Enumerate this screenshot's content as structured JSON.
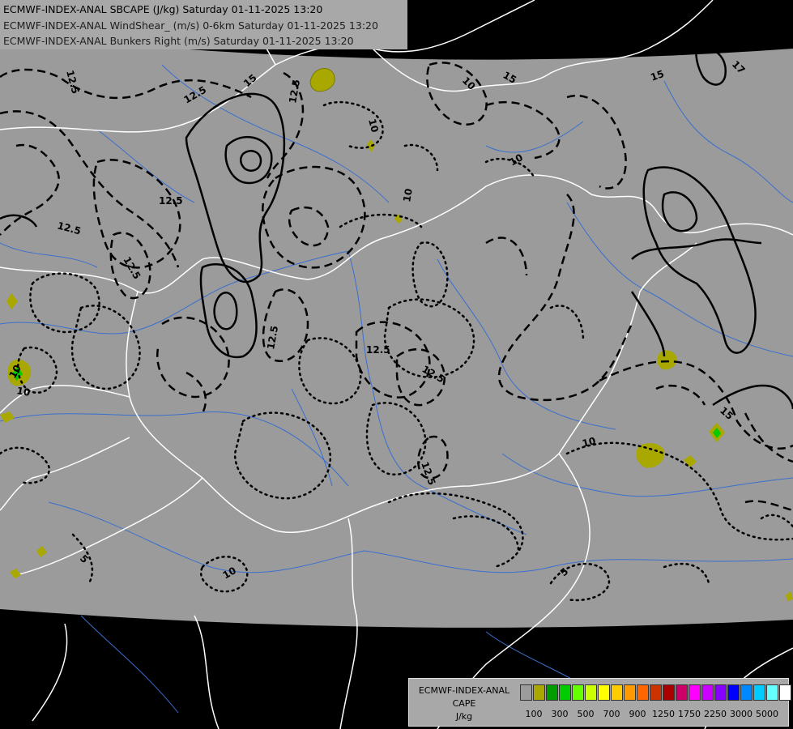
{
  "header": {
    "line1": "ECMWF-INDEX-ANAL SBCAPE (J/kg) Saturday 01-11-2025 13:20",
    "line2": "ECMWF-INDEX-ANAL WindShear_ (m/s) 0-6km Saturday 01-11-2025 13:20",
    "line3": "ECMWF-INDEX-ANAL Bunkers Right (m/s) Saturday 01-11-2025 13:20"
  },
  "legend": {
    "title1": "ECMWF-INDEX-ANAL",
    "title2": "CAPE",
    "title3": "J/kg",
    "colors": [
      "#9c9c9c",
      "#a8a800",
      "#009c00",
      "#00cc00",
      "#66ff00",
      "#ccff00",
      "#ffff00",
      "#ffcc00",
      "#ff9900",
      "#ff6600",
      "#cc3300",
      "#aa0000",
      "#cc0066",
      "#ff00ff",
      "#cc00ff",
      "#8800ff",
      "#0000ff",
      "#0088ff",
      "#00ccff",
      "#66ffff",
      "#ffffff"
    ],
    "ticks": [
      "100",
      "300",
      "500",
      "700",
      "900",
      "1250",
      "1750",
      "2250",
      "3000",
      "5000"
    ]
  },
  "map": {
    "colors": {
      "grey": "#9b9b9b",
      "black": "#000000",
      "border": "#ffffff",
      "river": "#3a6fcf",
      "cape": "#a8a800",
      "cape_high": "#00cc00"
    },
    "contour_labels": [
      "12.5",
      "12.5",
      "12.5",
      "12.5",
      "12.5",
      "12.5",
      "12.5",
      "12.5",
      "12.5",
      "12.5",
      "15",
      "15",
      "15",
      "15",
      "17",
      "10",
      "10",
      "10",
      "10",
      "10",
      "10",
      "10",
      "10",
      "5",
      "5"
    ]
  }
}
